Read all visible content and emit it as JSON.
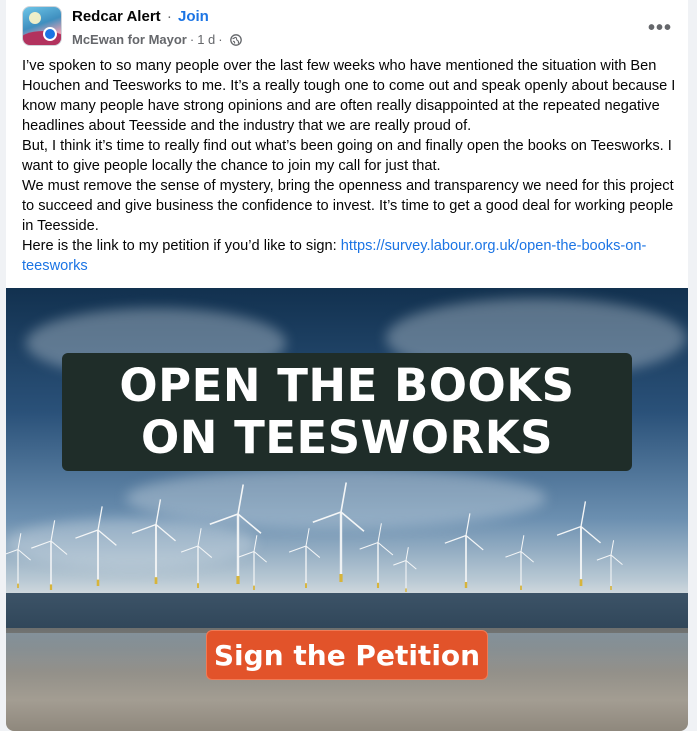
{
  "post": {
    "group_name": "Redcar Alert",
    "separator": "·",
    "join_label": "Join",
    "author": "McEwan for Mayor",
    "time": "1 d",
    "more_label": "•••",
    "paragraphs": [
      "I’ve spoken to so many people over the last few weeks who have mentioned the situation with Ben Houchen and Teesworks to me.  It’s a really tough one to come out and speak openly about because I know many people have strong opinions and are often really disappointed at the repeated negative headlines about Teesside and the industry that we are really proud of.",
      "But, I think it’s time to really find out what’s been going on and finally open the books on Teesworks. I want to give people locally the chance to join my call for just that.",
      "We must remove the sense of mystery, bring the openness and transparency we need for this project to succeed and give business the confidence to invest. It’s time to get a good deal for working people in Teesside."
    ],
    "petition_prefix": "Here is the link to my petition if you’d like to sign: ",
    "petition_link": "https://survey.labour.org.uk/open-the-books-on-teesworks"
  },
  "image": {
    "headline": "OPEN THE BOOKS\nON TEESWORKS",
    "cta_label": "Sign the Petition"
  },
  "icons": {
    "globe": "globe-icon",
    "more": "more-options-icon"
  },
  "colors": {
    "link": "#1b74e4",
    "cta": "#e2532a",
    "headline_bg": "#1f2d29"
  }
}
